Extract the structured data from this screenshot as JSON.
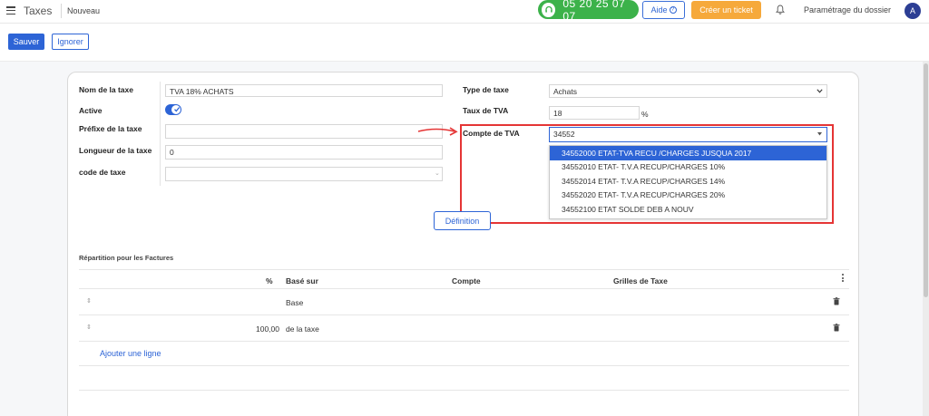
{
  "navbar": {
    "app_title": "Taxes",
    "breadcrumb": "Nouveau",
    "phone": "05 20 25 07 07",
    "help_label": "Aide",
    "ticket_label": "Créer un ticket",
    "settings_label": "Paramétrage du dossier",
    "avatar_initial": "A"
  },
  "controls": {
    "save_label": "Sauver",
    "discard_label": "Ignorer"
  },
  "form": {
    "name_label": "Nom de la taxe",
    "name_value": "TVA 18% ACHATS",
    "active_label": "Active",
    "active_value": true,
    "prefix_label": "Préfixe de la taxe",
    "prefix_value": "",
    "length_label": "Longueur de la taxe",
    "length_value": "0",
    "code_label": "code de taxe",
    "code_value": "",
    "type_label": "Type de taxe",
    "type_value": "Achats",
    "rate_label": "Taux de TVA",
    "rate_value": "18",
    "rate_unit": "%",
    "account_label": "Compte de TVA",
    "account_value": "34552"
  },
  "account_dropdown": {
    "options": [
      "34552000 ETAT-TVA RECU /CHARGES JUSQUA 2017",
      "34552010 ETAT- T.V.A RECUP/CHARGES 10%",
      "34552014 ETAT- T.V.A RECUP/CHARGES 14%",
      "34552020 ETAT- T.V.A RECUP/CHARGES 20%",
      "34552100 ETAT SOLDE DEB A NOUV"
    ]
  },
  "definition_button": "Définition",
  "distribution": {
    "title": "Répartition pour les Factures",
    "headers": {
      "percent": "%",
      "based_on": "Basé sur",
      "account": "Compte",
      "tax_grids": "Grilles de Taxe"
    },
    "rows": [
      {
        "percent": "",
        "based_on": "Base"
      },
      {
        "percent": "100,00",
        "based_on": "de la taxe"
      }
    ],
    "add_line": "Ajouter une ligne"
  },
  "colors": {
    "primary": "#2d64d6",
    "phone_green": "#3cb24a",
    "ticket_orange": "#f6a93b",
    "highlight_red": "#e53535"
  }
}
